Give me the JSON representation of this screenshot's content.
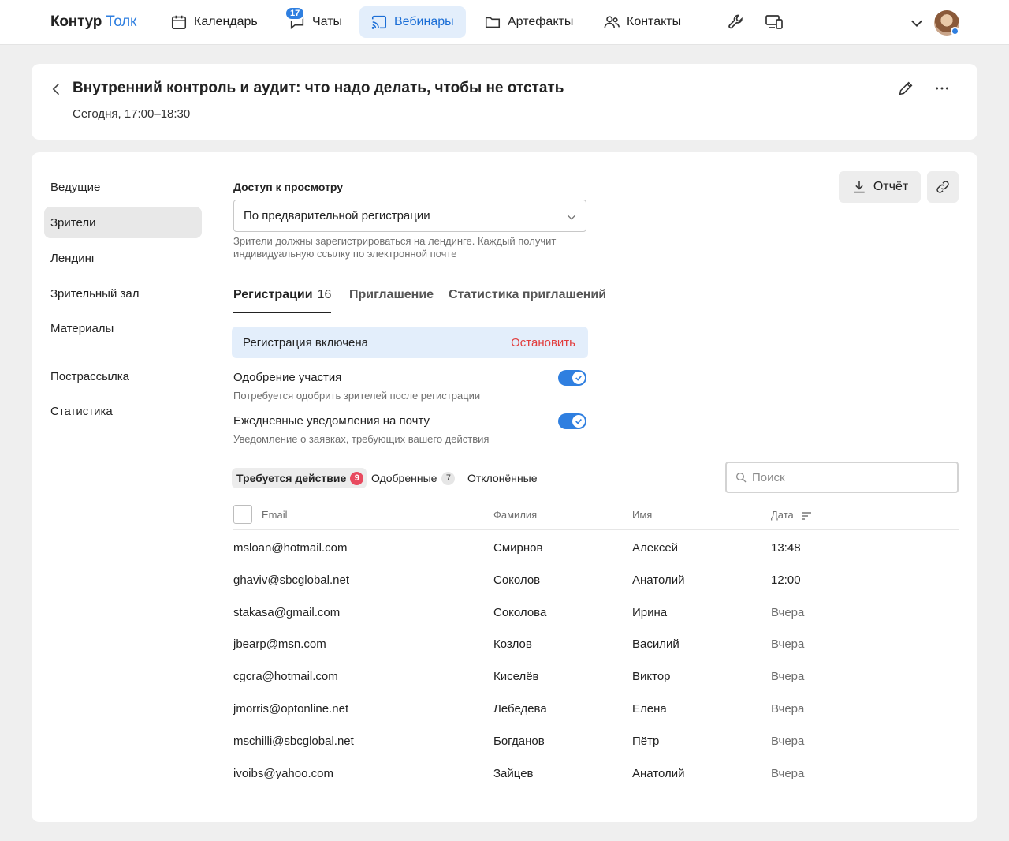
{
  "app": {
    "logo_main": "Контур",
    "logo_accent": "Толк"
  },
  "nav": {
    "calendar": "Календарь",
    "chats": "Чаты",
    "chats_badge": "17",
    "webinars": "Вебинары",
    "artifacts": "Артефакты",
    "contacts": "Контакты"
  },
  "event": {
    "title": "Внутренний контроль и аудит: что надо делать, чтобы не отстать",
    "time": "Сегодня, 17:00–18:30"
  },
  "sidebar": {
    "items": [
      {
        "label": "Ведущие"
      },
      {
        "label": "Зрители"
      },
      {
        "label": "Лендинг"
      },
      {
        "label": "Зрительный зал"
      },
      {
        "label": "Материалы"
      },
      {
        "label": "Пострассылка"
      },
      {
        "label": "Статистика"
      }
    ]
  },
  "access": {
    "label": "Доступ к просмотру",
    "selected": "По предварительной регистрации",
    "hint": "Зрители должны зарегистрироваться на лендинге. Каждый получит индивидуальную ссылку по электронной почте"
  },
  "actions": {
    "report": "Отчёт"
  },
  "tabs": {
    "registrations": "Регистрации",
    "registrations_count": "16",
    "invitation": "Приглашение",
    "invitation_stats": "Статистика приглашений"
  },
  "registration": {
    "status": "Регистрация включена",
    "stop": "Остановить"
  },
  "options": {
    "approval_title": "Одобрение участия",
    "approval_desc": "Потребуется одобрить зрителей после регистрации",
    "approval_on": true,
    "notify_title": "Ежедневные уведомления на почту",
    "notify_desc": "Уведомление о заявках, требующих вашего действия",
    "notify_on": true
  },
  "filters": {
    "action_required": "Требуется действие",
    "action_required_count": "9",
    "approved": "Одобренные",
    "approved_count": "7",
    "rejected": "Отклонённые"
  },
  "search": {
    "placeholder": "Поиск"
  },
  "table": {
    "headers": {
      "email": "Email",
      "last_name": "Фамилия",
      "first_name": "Имя",
      "date": "Дата"
    },
    "rows": [
      {
        "email": "msloan@hotmail.com",
        "last_name": "Смирнов",
        "first_name": "Алексей",
        "date": "13:48"
      },
      {
        "email": "ghaviv@sbcglobal.net",
        "last_name": "Соколов",
        "first_name": "Анатолий",
        "date": "12:00"
      },
      {
        "email": "stakasa@gmail.com",
        "last_name": "Соколова",
        "first_name": "Ирина",
        "date": "Вчера"
      },
      {
        "email": "jbearp@msn.com",
        "last_name": "Козлов",
        "first_name": "Василий",
        "date": "Вчера"
      },
      {
        "email": "cgcra@hotmail.com",
        "last_name": "Киселёв",
        "first_name": "Виктор",
        "date": "Вчера"
      },
      {
        "email": "jmorris@optonline.net",
        "last_name": "Лебедева",
        "first_name": "Елена",
        "date": "Вчера"
      },
      {
        "email": "mschilli@sbcglobal.net",
        "last_name": "Богданов",
        "first_name": "Пётр",
        "date": "Вчера"
      },
      {
        "email": "ivoibs@yahoo.com",
        "last_name": "Зайцев",
        "first_name": "Анатолий",
        "date": "Вчера"
      }
    ]
  }
}
